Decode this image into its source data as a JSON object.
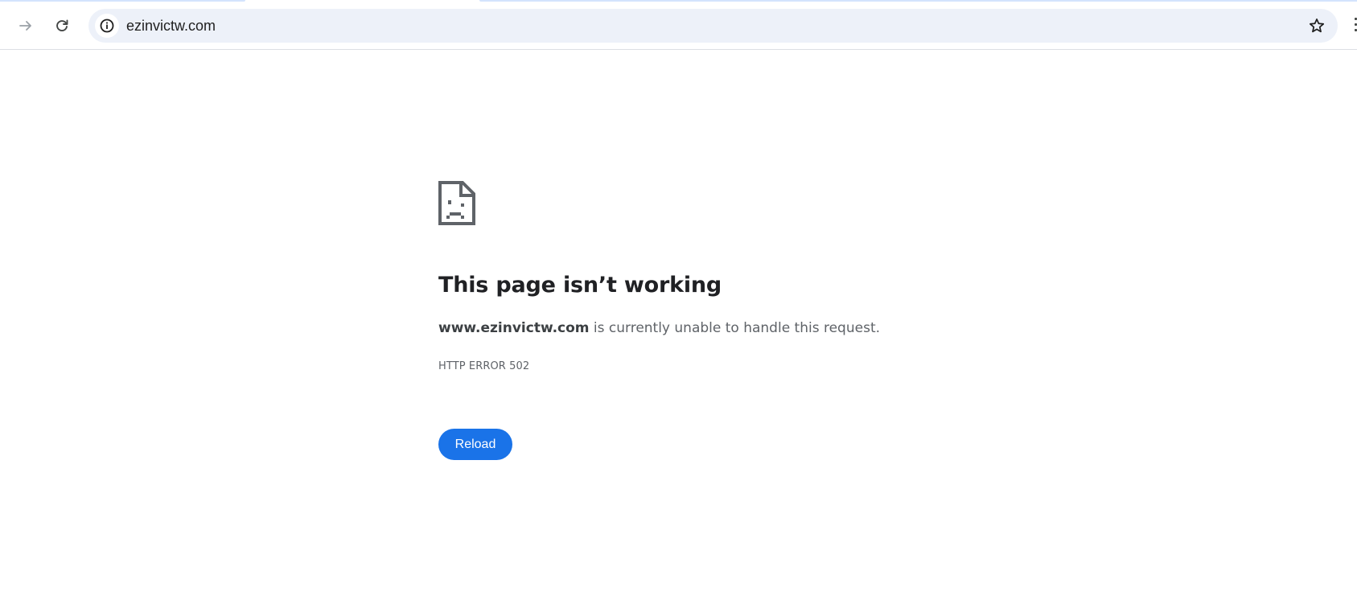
{
  "browser": {
    "url": "ezinvictw.com",
    "icons": {
      "forward": "arrow-right-icon",
      "reload": "reload-icon",
      "site_info": "info-icon",
      "bookmark": "star-icon"
    }
  },
  "error_page": {
    "icon": "sad-page-icon",
    "title": "This page isn’t working",
    "host": "www.ezinvictw.com",
    "message_rest": " is currently unable to handle this request.",
    "error_code": "HTTP ERROR 502",
    "reload_label": "Reload"
  },
  "colors": {
    "accent_button": "#1a73e8",
    "omnibox_bg": "#edf1f9",
    "title_text": "#202124",
    "body_text": "#5f6368"
  }
}
